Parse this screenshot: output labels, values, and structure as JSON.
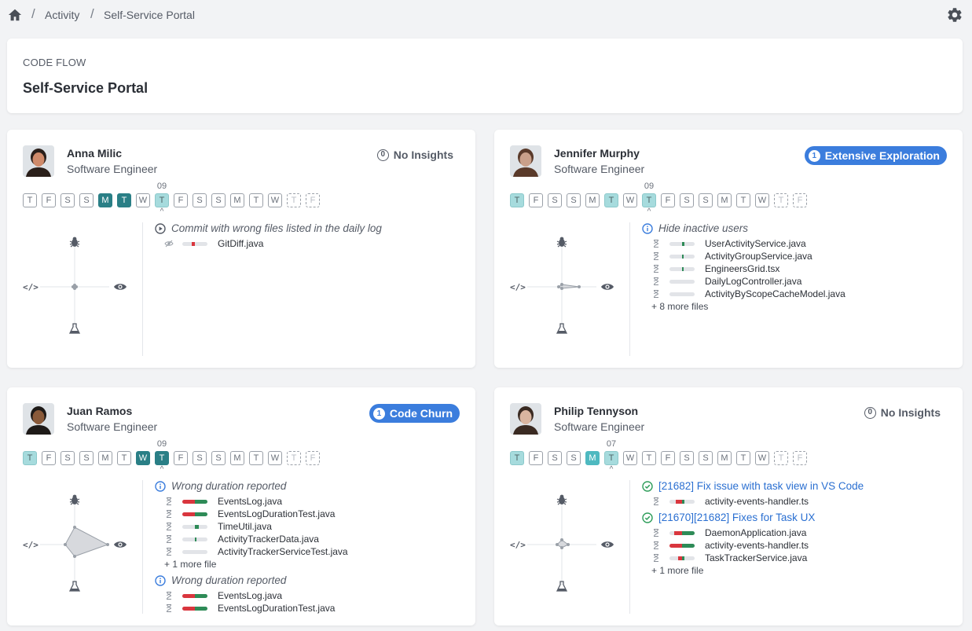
{
  "breadcrumb": {
    "level1": "Activity",
    "level2": "Self-Service Portal"
  },
  "header": {
    "label": "CODE FLOW",
    "title": "Self-Service Portal"
  },
  "colors": {
    "accent": "#3b7ddd",
    "dark_teal": "#2a7f86",
    "light_teal": "#a6dbdd",
    "mid_teal": "#4eb9c0",
    "red": "#d9363e",
    "green": "#2e8b57"
  },
  "cards": [
    {
      "name": "Anna Milic",
      "role": "Software Engineer",
      "badge": {
        "type": "none",
        "count": "0",
        "label": "No Insights"
      },
      "days": [
        "T",
        "F",
        "S",
        "S",
        "M",
        "T",
        "W",
        "T",
        "F",
        "S",
        "S",
        "M",
        "T",
        "W",
        "T",
        "F"
      ],
      "day_states": [
        "",
        "",
        "",
        "",
        "dark",
        "dark",
        "",
        "light",
        "",
        "",
        "",
        "",
        "",
        "",
        "disabled",
        "disabled"
      ],
      "week_label": "09",
      "insights": [
        {
          "icon": "play-circle-icon",
          "title": "Commit with wrong files listed in the daily log",
          "files": [
            {
              "icon": "eye-off-icon",
              "name": "GitDiff.java",
              "red": 0.12,
              "green": 0
            }
          ]
        }
      ]
    },
    {
      "name": "Jennifer Murphy",
      "role": "Software Engineer",
      "badge": {
        "type": "pill",
        "count": "1",
        "label": "Extensive Exploration"
      },
      "days": [
        "T",
        "F",
        "S",
        "S",
        "M",
        "T",
        "W",
        "T",
        "F",
        "S",
        "S",
        "M",
        "T",
        "W",
        "T",
        "F"
      ],
      "day_states": [
        "light",
        "",
        "",
        "",
        "",
        "light",
        "",
        "light",
        "",
        "",
        "",
        "",
        "",
        "",
        "disabled",
        "disabled"
      ],
      "week_label": "09",
      "insights": [
        {
          "icon": "info-icon",
          "title": "Hide inactive users",
          "files": [
            {
              "name": "UserActivityService.java",
              "red": 0,
              "green": 0.1
            },
            {
              "name": "ActivityGroupService.java",
              "red": 0,
              "green": 0.05
            },
            {
              "name": "EngineersGrid.tsx",
              "red": 0,
              "green": 0.05
            },
            {
              "name": "DailyLogController.java",
              "red": 0,
              "green": 0
            },
            {
              "name": "ActivityByScopeCacheModel.java",
              "red": 0,
              "green": 0
            }
          ],
          "more": "+ 8 more files"
        }
      ]
    },
    {
      "name": "Juan Ramos",
      "role": "Software Engineer",
      "badge": {
        "type": "pill",
        "count": "1",
        "label": "Code Churn"
      },
      "days": [
        "T",
        "F",
        "S",
        "S",
        "M",
        "T",
        "W",
        "T",
        "F",
        "S",
        "S",
        "M",
        "T",
        "W",
        "T",
        "F"
      ],
      "day_states": [
        "light",
        "",
        "",
        "",
        "",
        "",
        "dark",
        "dark",
        "",
        "",
        "",
        "",
        "",
        "",
        "disabled",
        "disabled"
      ],
      "week_label": "09",
      "insights": [
        {
          "icon": "info-icon",
          "title": "Wrong duration reported",
          "files": [
            {
              "name": "EventsLog.java",
              "red": 0.5,
              "green": 0.5
            },
            {
              "name": "EventsLogDurationTest.java",
              "red": 0.5,
              "green": 0.5
            },
            {
              "name": "TimeUtil.java",
              "red": 0,
              "green": 0.15
            },
            {
              "name": "ActivityTrackerData.java",
              "red": 0,
              "green": 0.05
            },
            {
              "name": "ActivityTrackerServiceTest.java",
              "red": 0,
              "green": 0
            }
          ],
          "more": "+ 1 more file"
        },
        {
          "icon": "info-icon",
          "title": "Wrong duration reported",
          "files": [
            {
              "name": "EventsLog.java",
              "red": 0.5,
              "green": 0.5
            },
            {
              "name": "EventsLogDurationTest.java",
              "red": 0.5,
              "green": 0.5
            }
          ]
        }
      ]
    },
    {
      "name": "Philip Tennyson",
      "role": "Software Engineer",
      "badge": {
        "type": "none",
        "count": "0",
        "label": "No Insights"
      },
      "days": [
        "T",
        "F",
        "S",
        "S",
        "M",
        "T",
        "W",
        "T",
        "F",
        "S",
        "S",
        "M",
        "T",
        "W",
        "T",
        "F"
      ],
      "day_states": [
        "light",
        "",
        "",
        "",
        "mid",
        "light",
        "",
        "",
        "",
        "",
        "",
        "",
        "",
        "",
        "disabled",
        "disabled"
      ],
      "week_label": "07",
      "insights": [
        {
          "icon": "check-circle-icon",
          "title": "[21682] Fix issue with task view in VS Code",
          "link": true,
          "files": [
            {
              "name": "activity-events-handler.ts",
              "red": 0.25,
              "green": 0.1
            }
          ]
        },
        {
          "icon": "check-circle-icon",
          "title": "[21670][21682] Fixes for Task UX",
          "link": true,
          "files": [
            {
              "name": "DaemonApplication.java",
              "red": 0.3,
              "green": 0.5
            },
            {
              "name": "activity-events-handler.ts",
              "red": 0.5,
              "green": 0.5
            },
            {
              "name": "TaskTrackerService.java",
              "red": 0.15,
              "green": 0.1
            }
          ],
          "more": "+ 1 more file"
        }
      ]
    }
  ]
}
